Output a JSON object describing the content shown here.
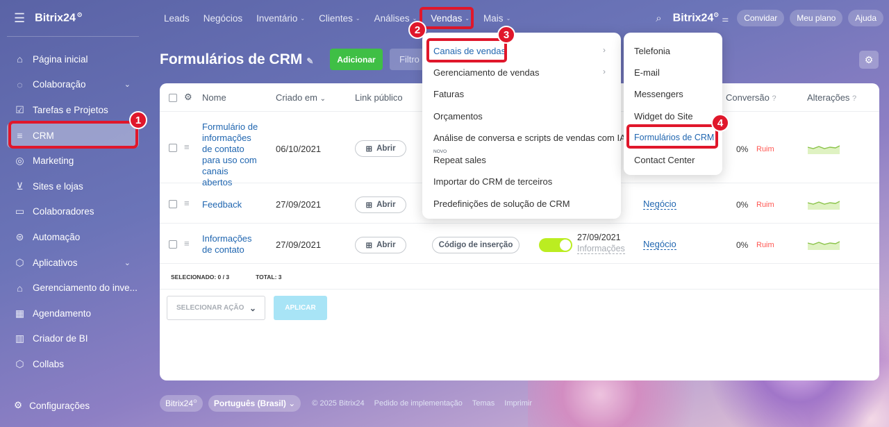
{
  "brand": "Bitrix24",
  "sidebar": {
    "items": [
      {
        "label": "Página inicial",
        "icon": "home-icon"
      },
      {
        "label": "Colaboração",
        "icon": "chat-icon",
        "chevron": true
      },
      {
        "label": "Tarefas e Projetos",
        "icon": "task-icon"
      },
      {
        "label": "CRM",
        "icon": "crm-funnel-icon",
        "active": true
      },
      {
        "label": "Marketing",
        "icon": "marketing-icon"
      },
      {
        "label": "Sites e lojas",
        "icon": "cart-icon"
      },
      {
        "label": "Colaboradores",
        "icon": "id-card-icon"
      },
      {
        "label": "Automação",
        "icon": "robot-icon"
      },
      {
        "label": "Aplicativos",
        "icon": "cube-icon",
        "chevron": true
      },
      {
        "label": "Gerenciamento do inve...",
        "icon": "warehouse-icon"
      },
      {
        "label": "Agendamento",
        "icon": "calendar-icon"
      },
      {
        "label": "Criador de BI",
        "icon": "bar-chart-icon"
      },
      {
        "label": "Collabs",
        "icon": "hexagon-icon"
      }
    ],
    "settings": "Configurações"
  },
  "topnav": {
    "items": [
      "Leads",
      "Negócios",
      "Inventário",
      "Clientes",
      "Análises",
      "Vendas",
      "Mais"
    ],
    "right": {
      "brand": "Bitrix24",
      "invite": "Convidar",
      "plan": "Meu plano",
      "help": "Ajuda"
    }
  },
  "page": {
    "title": "Formulários de CRM",
    "add": "Adicionar",
    "filter": "Filtro"
  },
  "table": {
    "headers": {
      "name": "Nome",
      "created": "Criado em",
      "link": "Link público",
      "conversion": "Conversão",
      "changes": "Alterações"
    },
    "rows": [
      {
        "name": "Formulário de informações de contato para uso com canais abertos",
        "date": "06/10/2021",
        "open": "Abrir",
        "conv": "0%",
        "rating": "Ruim"
      },
      {
        "name": "Feedback",
        "date": "27/09/2021",
        "open": "Abrir",
        "entity": "Negócio",
        "conv": "0%",
        "rating": "Ruim"
      },
      {
        "name": "Informações de contato",
        "date": "27/09/2021",
        "open": "Abrir",
        "code": "Código de inserção",
        "modified": "27/09/2021",
        "modified_sub": "Informações",
        "entity": "Negócio",
        "conv": "0%",
        "rating": "Ruim"
      }
    ],
    "selected": "SELECIONADO: 0 / 3",
    "total": "TOTAL: 3",
    "select_action": "SELECIONAR AÇÃO",
    "apply": "APLICAR"
  },
  "menu1": {
    "items": [
      "Canais de vendas",
      "Gerenciamento de vendas",
      "Faturas",
      "Orçamentos",
      "Análise de conversa e scripts de vendas com IA",
      "Repeat sales",
      "Importar do CRM de terceiros",
      "Predefinições de solução de CRM"
    ],
    "new_tag": "NOVO"
  },
  "menu2": {
    "items": [
      "Telefonia",
      "E-mail",
      "Messengers",
      "Widget do Site",
      "Formulários de CRM",
      "Contact Center"
    ]
  },
  "badges": [
    "1",
    "2",
    "3",
    "4"
  ],
  "bottom": {
    "brand": "Bitrix24",
    "lang": "Português (Brasil)",
    "copyright": "© 2025 Bitrix24",
    "links": [
      "Pedido de implementação",
      "Temas",
      "Imprimir"
    ]
  }
}
